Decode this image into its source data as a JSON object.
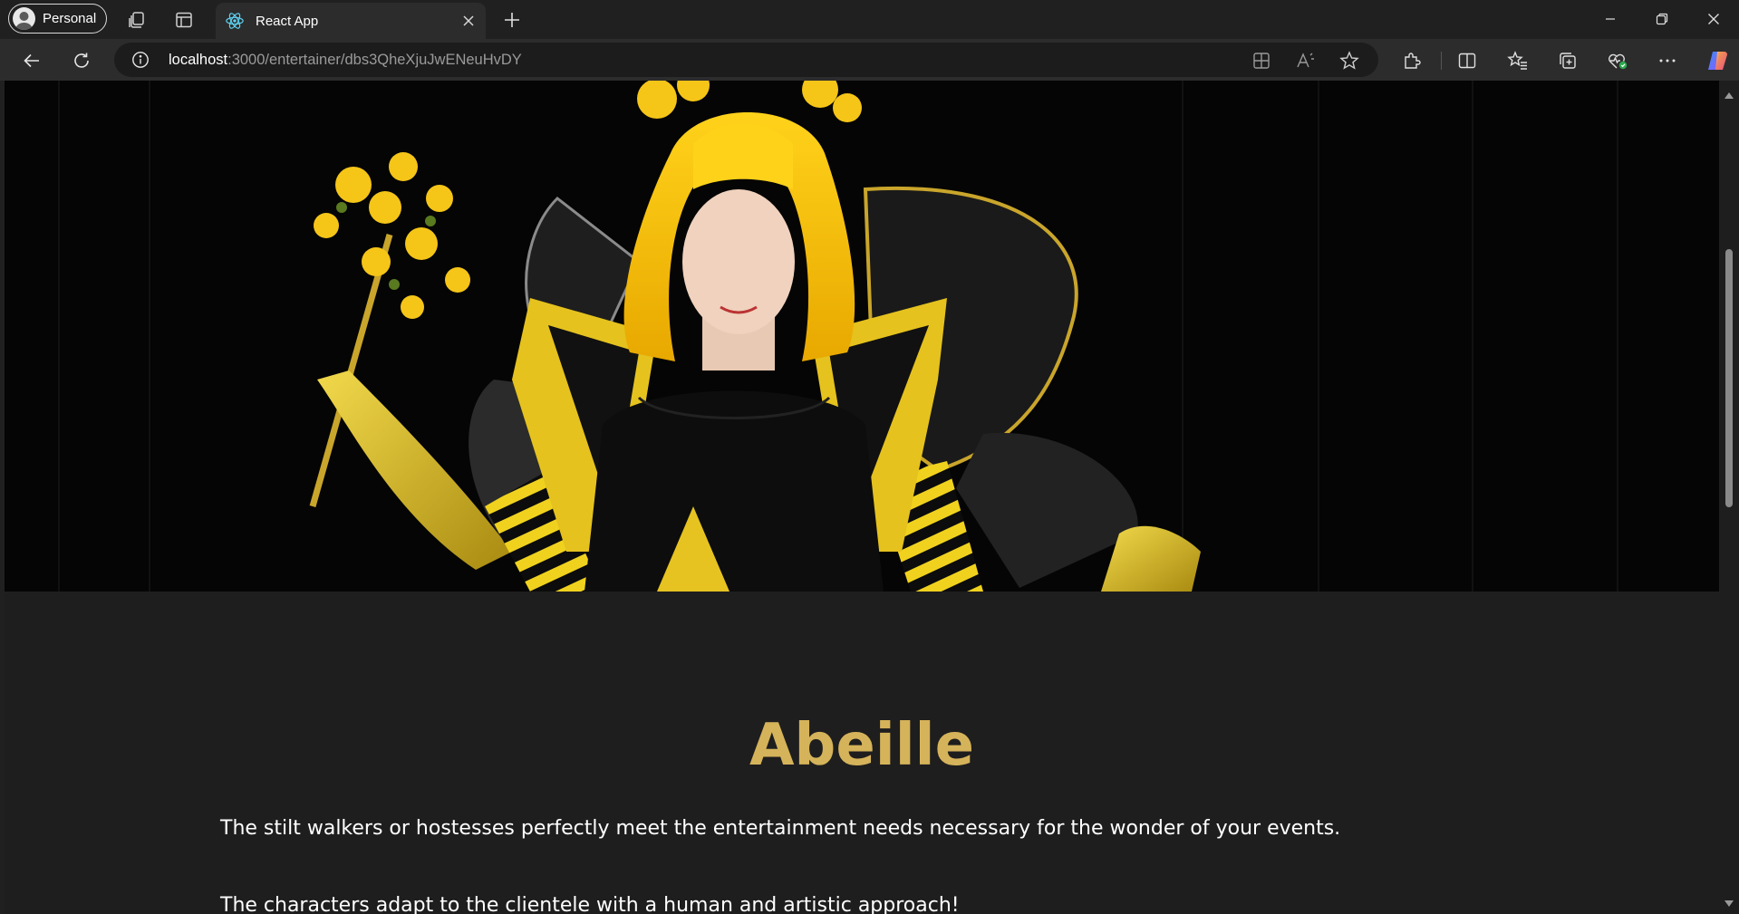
{
  "browser": {
    "profile_label": "Personal",
    "tab": {
      "title": "React App"
    },
    "address": {
      "host": "localhost",
      "path": ":3000/entertainer/dbs3QheXjuJwENeuHvDY"
    }
  },
  "page": {
    "title": "Abeille",
    "paragraphs": [
      "The stilt walkers or hostesses perfectly meet the entertainment needs necessary for the wonder of your events.",
      "The characters adapt to the clientele with a human and artistic approach!"
    ]
  },
  "colors": {
    "accent": "#d5b35a",
    "page_bg": "#1e1e1e",
    "chrome_bg": "#202020",
    "toolbar_bg": "#2c2c2c"
  },
  "icons": [
    "workspaces-icon",
    "vertical-tabs-icon",
    "react-icon",
    "close-icon",
    "plus-icon",
    "minimize-icon",
    "restore-icon",
    "window-close-icon",
    "back-icon",
    "refresh-icon",
    "info-icon",
    "app-available-icon",
    "read-aloud-icon",
    "star-icon",
    "extensions-icon",
    "split-screen-icon",
    "favorites-icon",
    "collections-icon",
    "browser-essentials-icon",
    "more-icon",
    "copilot-icon"
  ]
}
